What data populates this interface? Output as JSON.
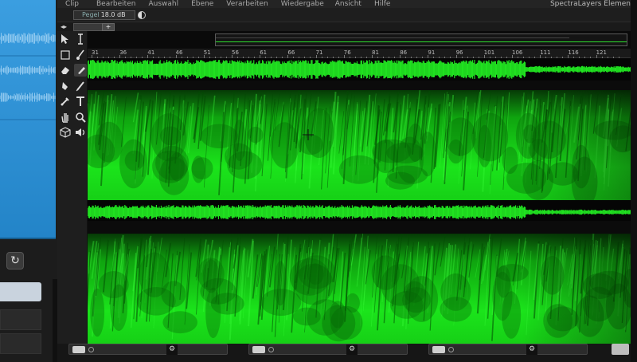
{
  "menu": {
    "items": [
      "Clip",
      "Bearbeiten",
      "Auswahl",
      "Ebene",
      "Verarbeiten",
      "Wiedergabe",
      "Ansicht",
      "Hilfe"
    ],
    "app_title": "SpectraLayers Elemen"
  },
  "options": {
    "level_label": "Pegel",
    "level_value": "18.0 dB"
  },
  "tabs": {
    "nav_arrows": "◂▸",
    "add_label": "+"
  },
  "ruler": {
    "ticks": [
      "31",
      "36",
      "41",
      "46",
      "51",
      "56",
      "61",
      "66",
      "71",
      "76",
      "81",
      "86",
      "91",
      "96",
      "101",
      "106",
      "111",
      "116",
      "121"
    ]
  },
  "tools": [
    {
      "name": "multi-select-tool-icon",
      "glyph": "arrow"
    },
    {
      "name": "time-select-tool-icon",
      "glyph": "I"
    },
    {
      "name": "rectangle-select-tool-icon",
      "glyph": "rect"
    },
    {
      "name": "brush-select-tool-icon",
      "glyph": "brush"
    },
    {
      "name": "eraser-tool-icon",
      "glyph": "eraser"
    },
    {
      "name": "eraser-soft-tool-icon",
      "glyph": "eraser2"
    },
    {
      "name": "clone-tool-icon",
      "glyph": "drop"
    },
    {
      "name": "pencil-tool-icon",
      "glyph": "pen"
    },
    {
      "name": "dropper-tool-icon",
      "glyph": "dropper"
    },
    {
      "name": "text-tool-icon",
      "glyph": "T"
    },
    {
      "name": "hand-tool-icon",
      "glyph": "hand"
    },
    {
      "name": "zoom-tool-icon",
      "glyph": "zoom"
    },
    {
      "name": "cube-tool-icon",
      "glyph": "cube"
    },
    {
      "name": "speaker-tool-icon",
      "glyph": "speaker"
    }
  ],
  "host": {
    "redo_icon": "↻"
  },
  "colors": {
    "spectrum": "#14e014",
    "waveform": "#2ef02e",
    "host_clip": "#3b9ee0"
  },
  "controls": {
    "gear_glyph": "⚙"
  }
}
